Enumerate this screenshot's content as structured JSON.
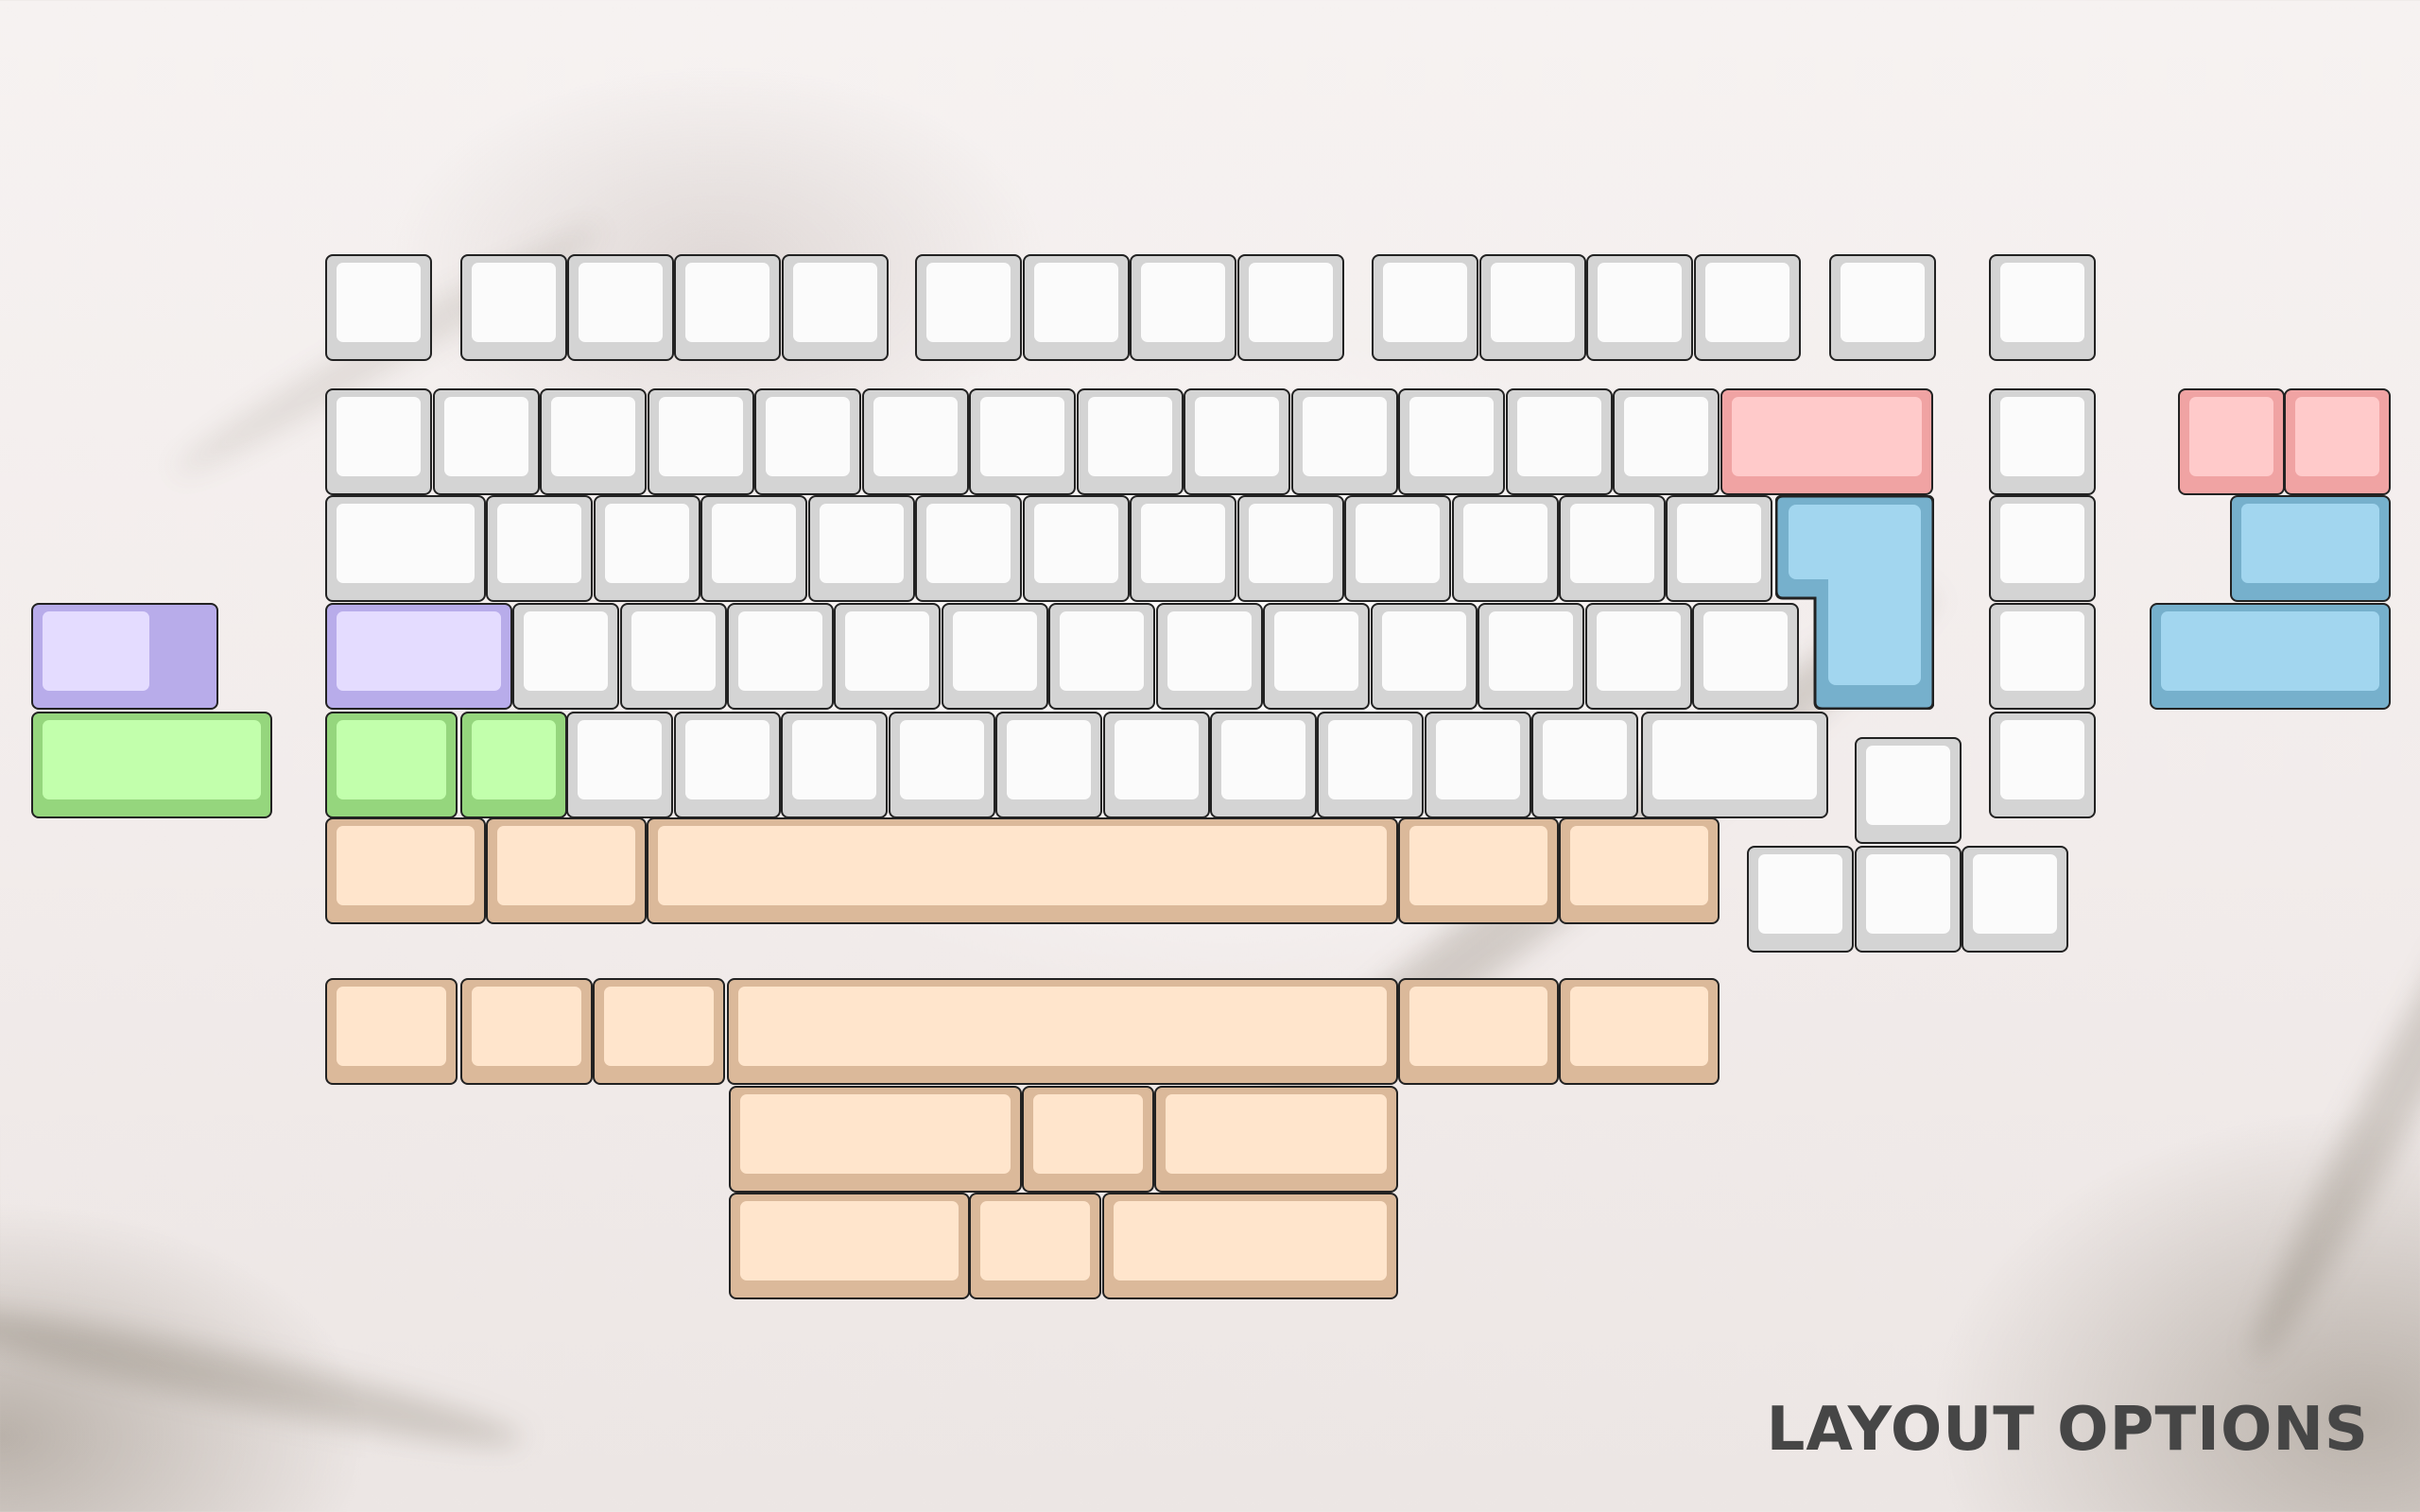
{
  "title": "LAYOUT OPTIONS",
  "colors": {
    "white": {
      "top": "#fbfbfb",
      "side": "#d4d4d4"
    },
    "red": {
      "top": "#ffcaca",
      "side": "#f0a3a3"
    },
    "blue": {
      "top": "#a2d6ef",
      "side": "#76b0cc"
    },
    "purple": {
      "top": "#e4dcff",
      "side": "#b8acea"
    },
    "green": {
      "top": "#c2ffac",
      "side": "#95d67d"
    },
    "peach": {
      "top": "#ffe5cc",
      "side": "#dbb99a"
    }
  },
  "key_groups": [
    {
      "name": "function-row",
      "color": "white",
      "count": 15
    },
    {
      "name": "number-row",
      "color": "white",
      "count": 14
    },
    {
      "name": "backspace-options",
      "color": "red",
      "count": 3
    },
    {
      "name": "top-alpha-row",
      "color": "white",
      "count": 14
    },
    {
      "name": "enter-options",
      "color": "blue",
      "count": 3
    },
    {
      "name": "home-row",
      "color": "white",
      "count": 13
    },
    {
      "name": "caps-lock-options",
      "color": "purple",
      "count": 2
    },
    {
      "name": "bottom-alpha-row",
      "color": "white",
      "count": 12
    },
    {
      "name": "left-shift-options",
      "color": "green",
      "count": 3
    },
    {
      "name": "navigation-column",
      "color": "white",
      "count": 5
    },
    {
      "name": "arrow-cluster",
      "color": "white",
      "count": 4
    },
    {
      "name": "bottom-row-options",
      "color": "peach",
      "count": 17
    }
  ]
}
